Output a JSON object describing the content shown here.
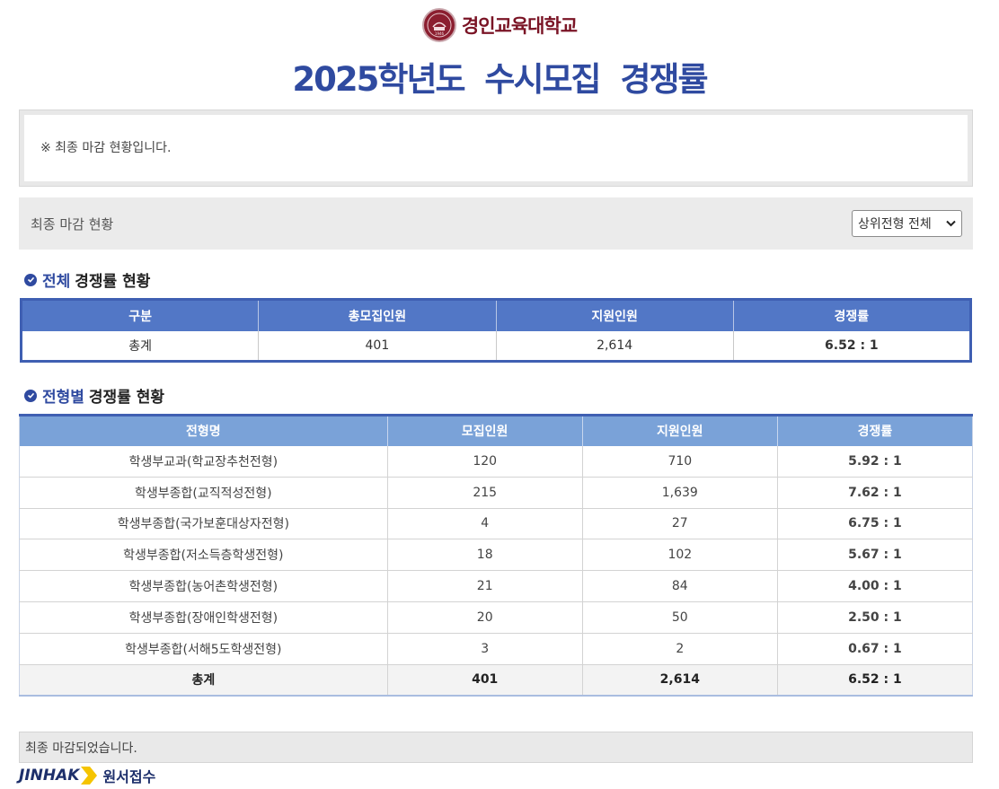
{
  "header": {
    "university_name": "경인교육대학교",
    "seal_text": "1946",
    "page_title": "2025학년도 수시모집 경쟁률"
  },
  "notice": {
    "text": "※ 최종 마감 현황입니다."
  },
  "filter": {
    "label": "최종 마감 현황",
    "select_value": "상위전형 전체"
  },
  "total_section": {
    "title_accent": "전체",
    "title_rest": "경쟁률 현황",
    "columns": [
      "구분",
      "총모집인원",
      "지원인원",
      "경쟁률"
    ],
    "row": [
      "총계",
      "401",
      "2,614",
      "6.52 : 1"
    ]
  },
  "type_section": {
    "title_accent": "전형별",
    "title_rest": "경쟁률 현황",
    "columns": [
      "전형명",
      "모집인원",
      "지원인원",
      "경쟁률"
    ],
    "rows": [
      [
        "학생부교과(학교장추천전형)",
        "120",
        "710",
        "5.92 : 1"
      ],
      [
        "학생부종합(교직적성전형)",
        "215",
        "1,639",
        "7.62 : 1"
      ],
      [
        "학생부종합(국가보훈대상자전형)",
        "4",
        "27",
        "6.75 : 1"
      ],
      [
        "학생부종합(저소득층학생전형)",
        "18",
        "102",
        "5.67 : 1"
      ],
      [
        "학생부종합(농어촌학생전형)",
        "21",
        "84",
        "4.00 : 1"
      ],
      [
        "학생부종합(장애인학생전형)",
        "20",
        "50",
        "2.50 : 1"
      ],
      [
        "학생부종합(서해5도학생전형)",
        "3",
        "2",
        "0.67 : 1"
      ]
    ],
    "sum_row": [
      "총계",
      "401",
      "2,614",
      "6.52 : 1"
    ]
  },
  "footer": {
    "status_text": "최종 마감되었습니다.",
    "brand_word": "JINHAK",
    "brand_sub": "원서접수"
  },
  "colors": {
    "title_blue": "#2f4aa0",
    "header_dark_blue": "#5277c6",
    "header_light_blue": "#7aa2d8",
    "logo_maroon": "#7a1425",
    "jinhak_yellow": "#f5c400"
  }
}
